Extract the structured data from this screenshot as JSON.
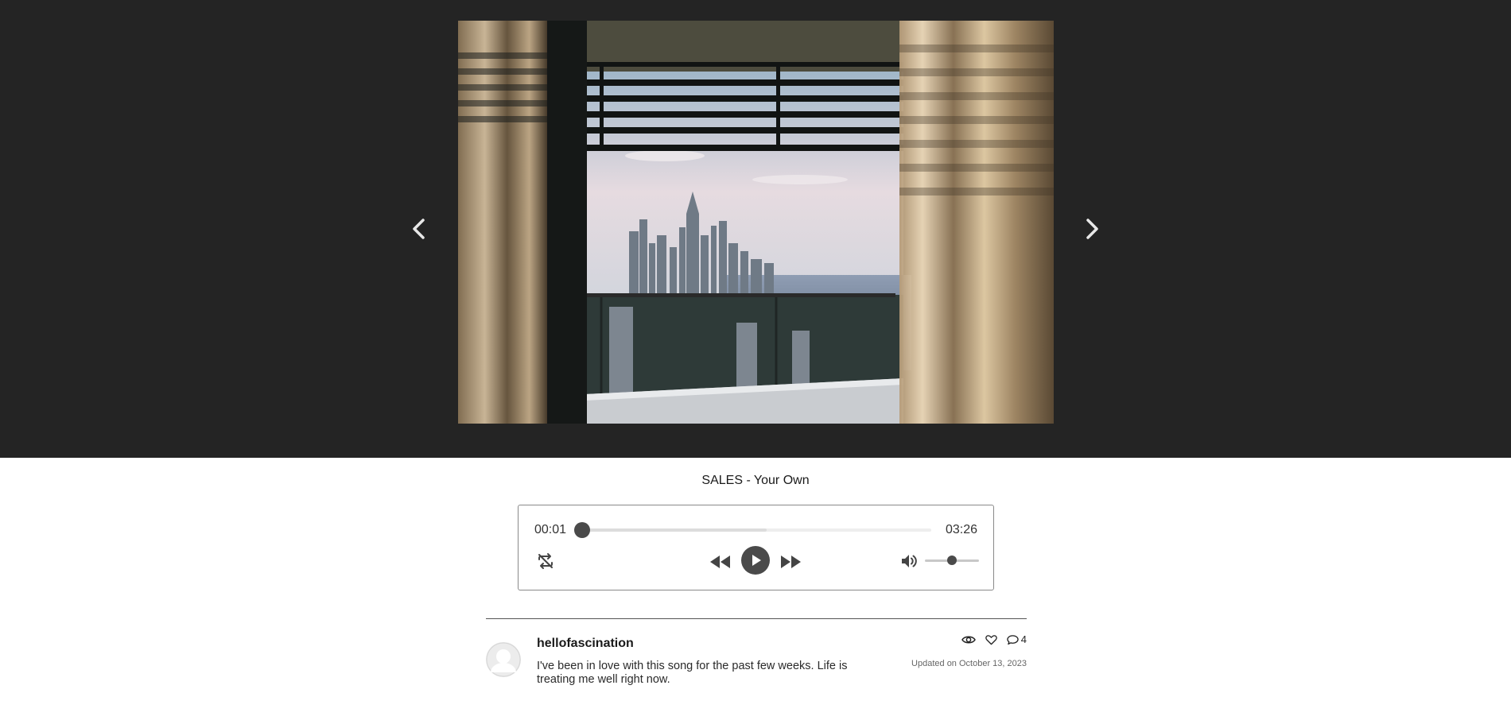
{
  "hero": {
    "image_alt": "Balcony view of a city skyline through sheer curtains"
  },
  "player": {
    "track_title": "SALES - Your Own",
    "current_time": "00:01",
    "duration": "03:26",
    "progress_fraction": 0.0,
    "buffered_fraction": 0.53,
    "volume_fraction": 0.5
  },
  "post": {
    "username": "hellofascination",
    "comment": "I've been in love with this song for the past few weeks. Life is treating me well right now.",
    "updated": "Updated on October 13, 2023",
    "comment_count": "4"
  },
  "icons": [
    "chevron-left-icon",
    "chevron-right-icon",
    "repeat-icon",
    "rewind-icon",
    "play-icon",
    "fast-forward-icon",
    "volume-icon",
    "eye-icon",
    "heart-icon",
    "comment-icon",
    "avatar-icon"
  ]
}
